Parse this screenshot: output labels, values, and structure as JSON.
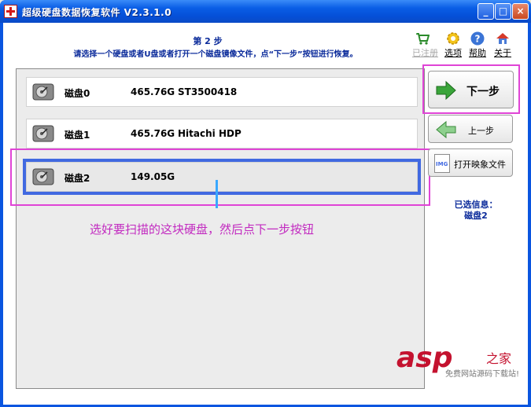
{
  "window": {
    "title": "超级硬盘数据恢复软件 V2.3.1.0",
    "minimize_label": "_",
    "maximize_label": "□",
    "close_label": "×"
  },
  "header": {
    "step": "第 2 步",
    "description": "请选择一个硬盘或者U盘或者打开一个磁盘镜像文件，点“下一步”按钮进行恢复。"
  },
  "toolbar": [
    {
      "label": "已注册",
      "icon": "cart-icon",
      "enabled": false
    },
    {
      "label": "选项",
      "icon": "gear-icon",
      "enabled": true
    },
    {
      "label": "帮助",
      "icon": "help-icon",
      "enabled": true
    },
    {
      "label": "关于",
      "icon": "home-icon",
      "enabled": true
    }
  ],
  "disks": [
    {
      "name": "磁盘0",
      "size": "465.76G",
      "model": "ST3500418",
      "selected": false
    },
    {
      "name": "磁盘1",
      "size": "465.76G",
      "model": "Hitachi HDP",
      "selected": false
    },
    {
      "name": "磁盘2",
      "size": "149.05G",
      "model": "",
      "selected": true
    }
  ],
  "hint": "选好要扫描的这块硬盘，然后点下一步按钮",
  "buttons": {
    "next": "下一步",
    "prev": "上一步",
    "open_image": "打开映象文件",
    "img_badge": "IMG"
  },
  "selected_info": {
    "label": "已选信息：",
    "value": "磁盘2"
  },
  "watermark": {
    "brand": "asp",
    "cn": "之家",
    "sub": "免费网站源码下载站!"
  },
  "colors": {
    "title_blue": "#0a2a9a",
    "highlight_magenta": "#e044d6",
    "selection_blue": "#4169e1",
    "arrow_green": "#3aa53a"
  }
}
